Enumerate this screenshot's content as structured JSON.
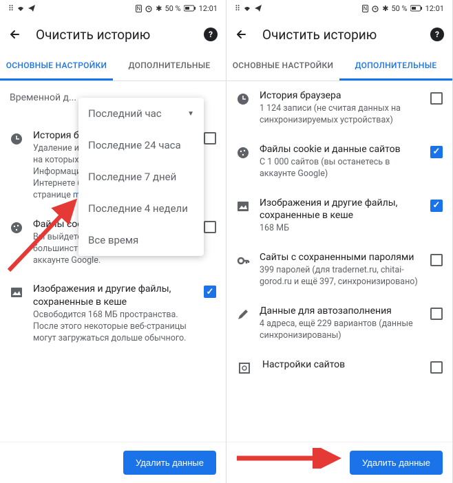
{
  "status": {
    "signal": "📶",
    "wifi": "📡",
    "plane_off": "✈",
    "nfc": "N",
    "alarm": "⏰",
    "bt": "✱",
    "battery_pct": "50 %",
    "time": "12:01"
  },
  "header": {
    "title": "Очистить историю"
  },
  "tabs": {
    "basic": "ОСНОВНЫЕ НАСТРОЙКИ",
    "advanced": "ДОПОЛНИТЕЛЬНЫЕ"
  },
  "left": {
    "time_label": "Временной д...",
    "dropdown": {
      "selected": "Последний час",
      "options": [
        "Последние 24 часа",
        "Последние 7 дней",
        "Последние 4 недели",
        "Все время"
      ]
    },
    "items": [
      {
        "title": "История браузера",
        "desc_prefix": "Удаление истории со всех устройств, на которых выполнен вход в аккаунт. Информация о других действиях в Интернете будет также храниться на странице ",
        "desc_link": "myactivity.google.com",
        "checked": false
      },
      {
        "title": "Файлы cookie и данные сайтов",
        "desc": "Вы выйдете из аккаунтов на большинстве сайтов, но останетесь в аккаунте Google.",
        "checked": false
      },
      {
        "title": "Изображения и другие файлы, сохраненные в кеше",
        "desc": "Освободится 168 МБ пространства. После этого некоторые веб-страницы могут загружаться дольше обычного.",
        "checked": true
      }
    ]
  },
  "right": {
    "items": [
      {
        "title": "История браузера",
        "desc": "1 124 записи (не считая данных на синхронизируемых устройствах)",
        "checked": false
      },
      {
        "title": "Файлы cookie и данные сайтов",
        "desc": "С 1 000 сайтов (вы останетесь в аккаунте Google)",
        "checked": true
      },
      {
        "title": "Изображения и другие файлы, сохраненные в кеше",
        "desc": "168 МБ",
        "checked": true
      },
      {
        "title": "Сайты с сохраненными паролями",
        "desc": "399 паролей (для tradernet.ru, chitai-gorod.ru и ещё 397, синхронизировано)",
        "checked": false
      },
      {
        "title": "Данные для автозаполнения",
        "desc": "4 адреса, ещё 229 вариантов (данные синхронизированы)",
        "checked": false
      },
      {
        "title": "Настройки сайтов",
        "desc": "",
        "checked": false
      }
    ]
  },
  "footer": {
    "delete": "Удалить данные"
  }
}
